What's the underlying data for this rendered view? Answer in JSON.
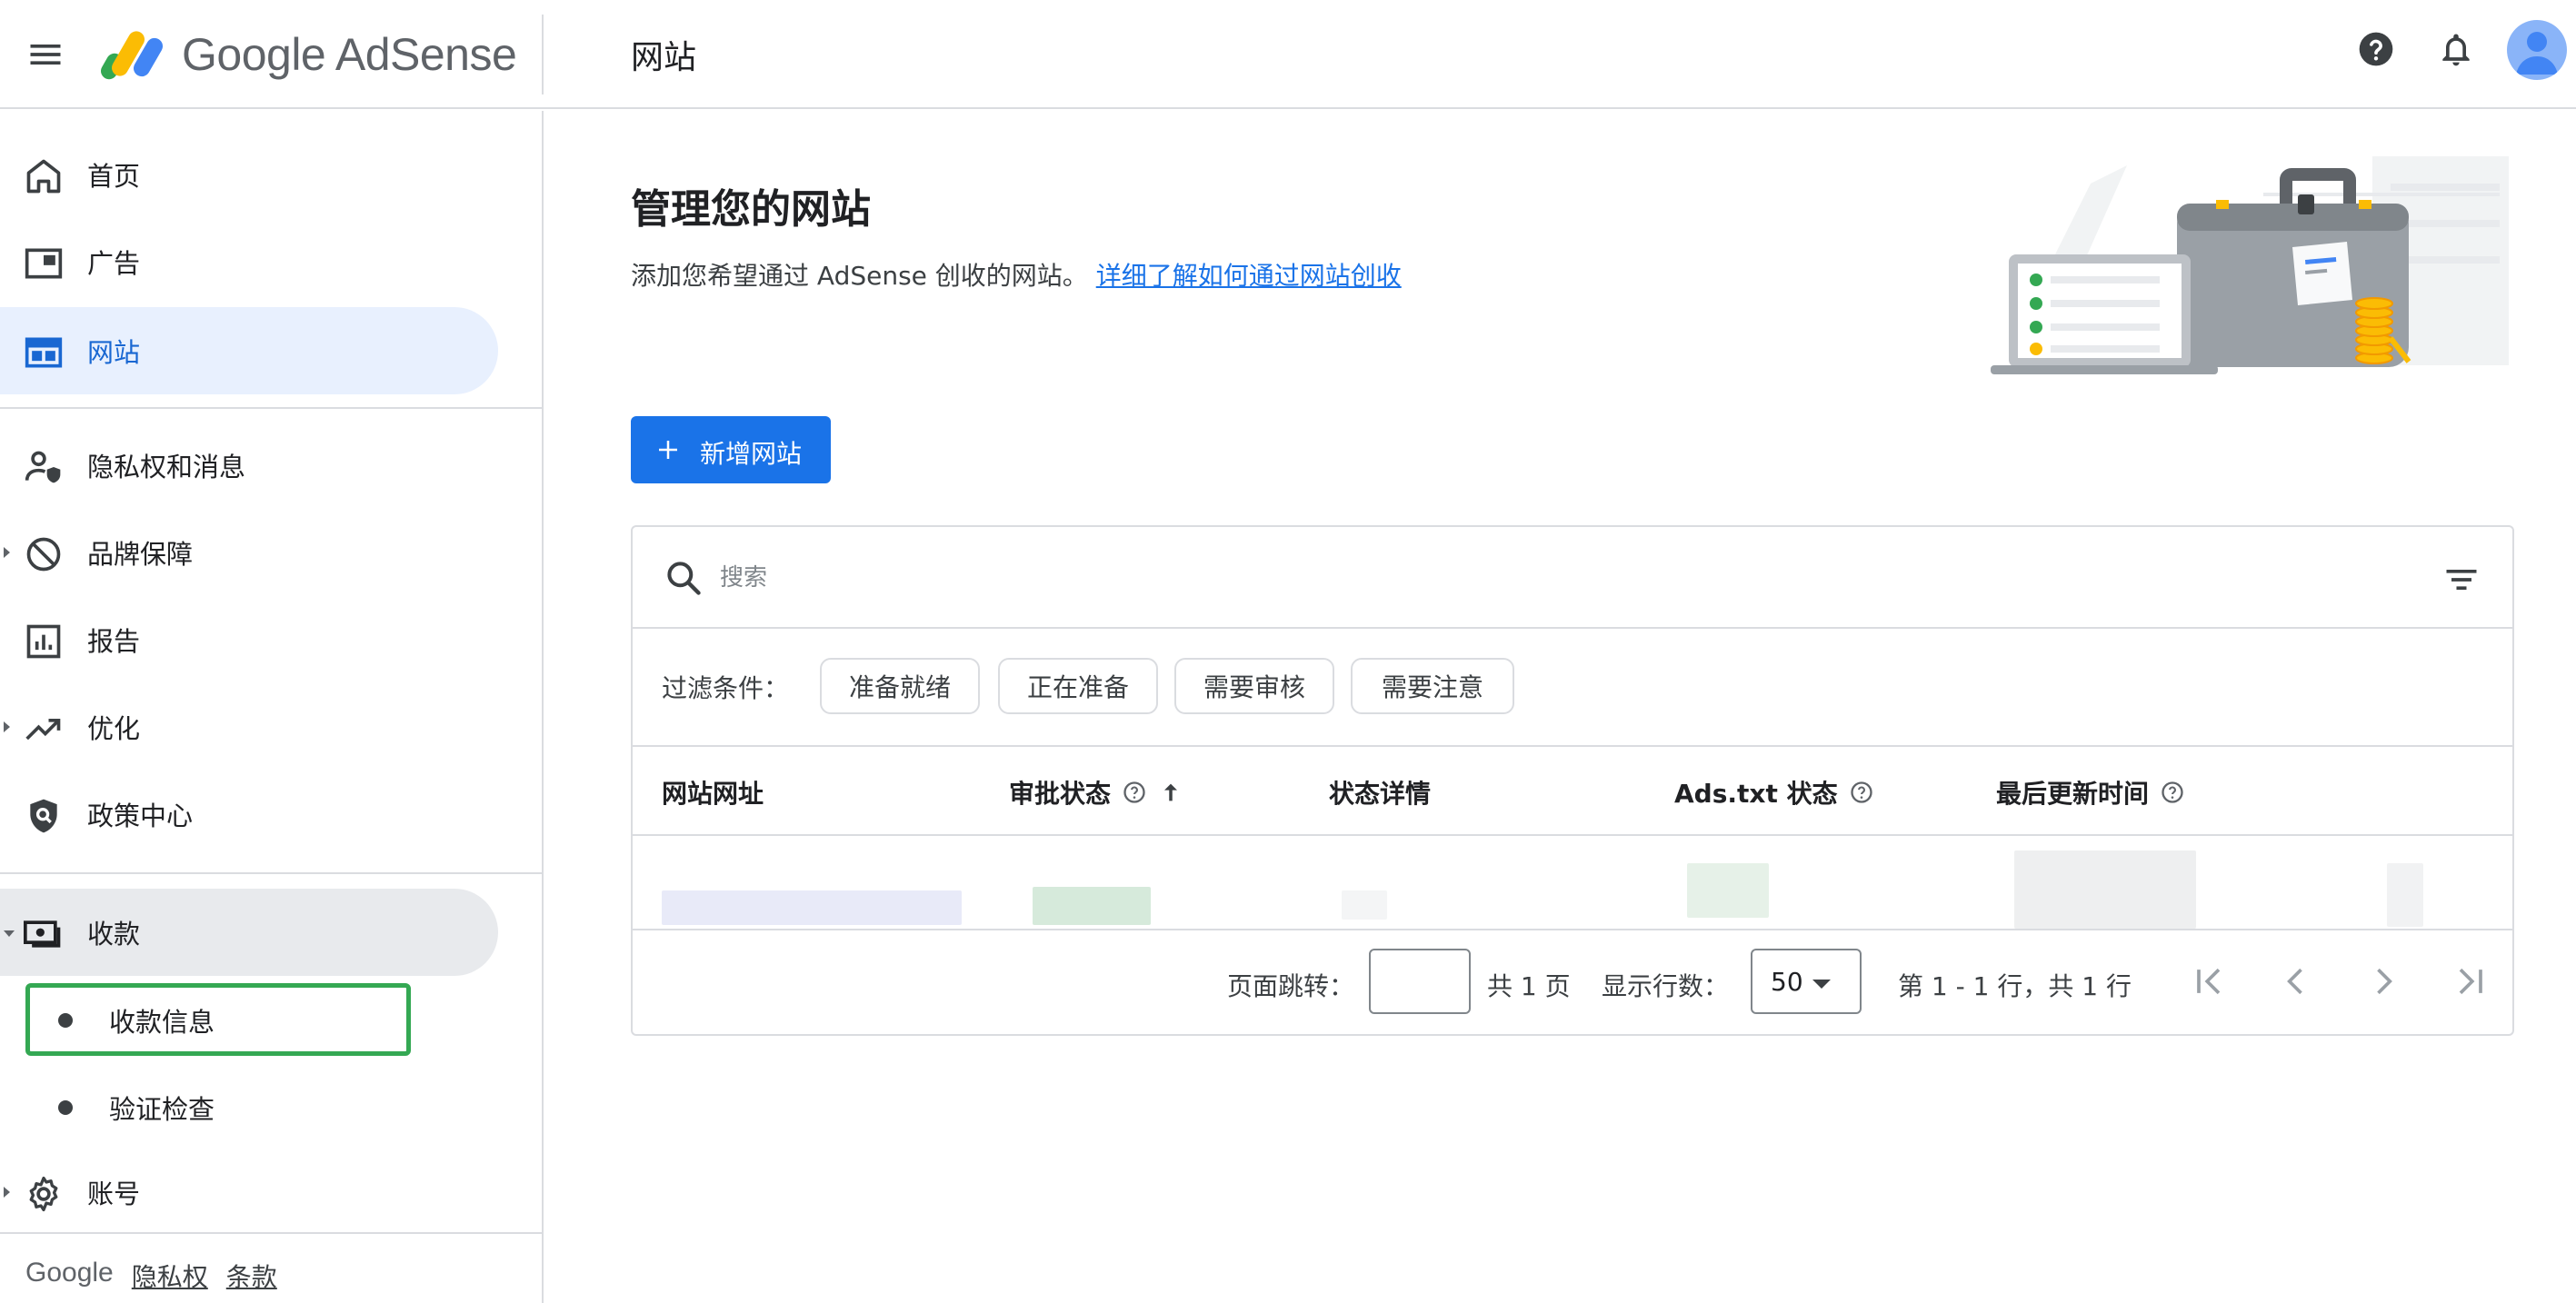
{
  "app": {
    "logo_text": "Google AdSense",
    "page_title": "网站"
  },
  "sidebar": {
    "items": [
      {
        "label": "首页",
        "icon": "home-icon"
      },
      {
        "label": "广告",
        "icon": "ads-icon"
      },
      {
        "label": "网站",
        "icon": "sites-icon"
      },
      {
        "label": "隐私权和消息",
        "icon": "privacy-icon"
      },
      {
        "label": "品牌保障",
        "icon": "block-icon"
      },
      {
        "label": "报告",
        "icon": "reports-icon"
      },
      {
        "label": "优化",
        "icon": "trending-icon"
      },
      {
        "label": "政策中心",
        "icon": "policy-shield-icon"
      },
      {
        "label": "收款",
        "icon": "payments-icon"
      },
      {
        "label": "账号",
        "icon": "settings-gear-icon"
      }
    ],
    "payments_sub": [
      {
        "label": "收款信息"
      },
      {
        "label": "验证检查"
      }
    ],
    "footer": {
      "brand": "Google",
      "privacy": "隐私权",
      "terms": "条款"
    }
  },
  "main": {
    "title": "管理您的网站",
    "description": "添加您希望通过 AdSense 创收的网站。",
    "learn_more_link": "详细了解如何通过网站创收",
    "add_button": "新增网站",
    "search_placeholder": "搜索",
    "filter_label": "过滤条件：",
    "chips": [
      "准备就绪",
      "正在准备",
      "需要审核",
      "需要注意"
    ],
    "columns": [
      "网站网址",
      "审批状态",
      "状态详情",
      "Ads.txt 状态",
      "最后更新时间"
    ],
    "pagination": {
      "goto_label": "页面跳转：",
      "goto_value": "",
      "total_pages": "共 1 页",
      "rows_label": "显示行数：",
      "rows_value": "50",
      "range": "第 1 - 1 行，共 1 行"
    }
  },
  "colors": {
    "primary": "#1a73e8",
    "active_nav_bg": "#e8f0fe",
    "highlight_border": "#34a853"
  }
}
